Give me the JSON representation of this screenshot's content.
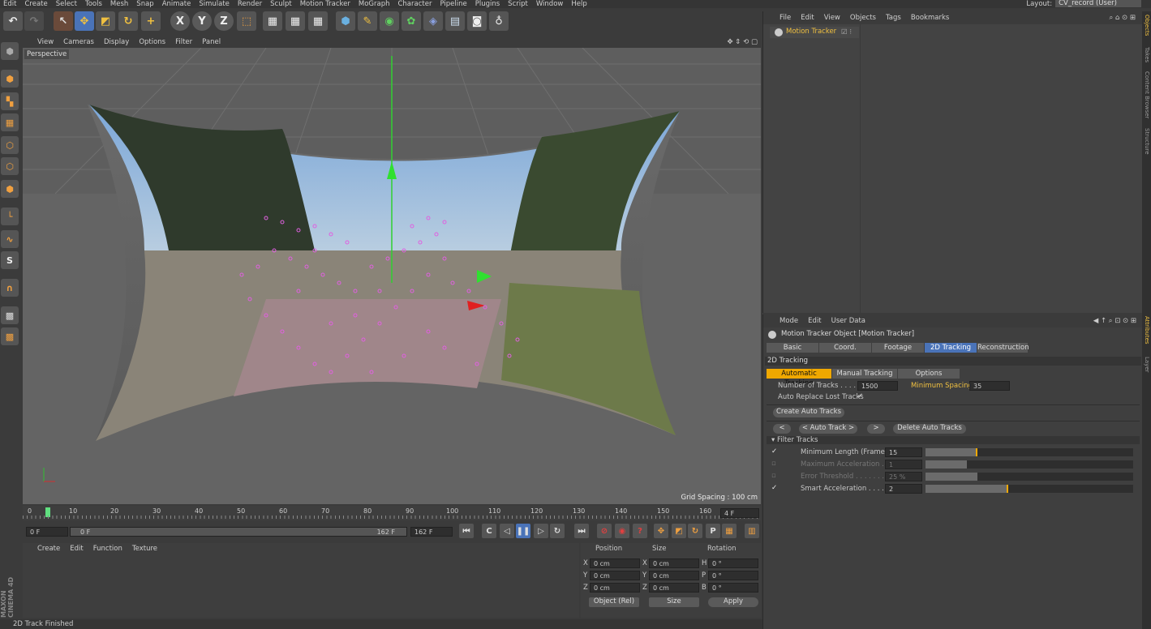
{
  "menu": [
    "Edit",
    "Create",
    "Select",
    "Tools",
    "Mesh",
    "Snap",
    "Animate",
    "Simulate",
    "Render",
    "Sculpt",
    "Motion Tracker",
    "MoGraph",
    "Character",
    "Pipeline",
    "Plugins",
    "Script",
    "Window",
    "Help"
  ],
  "layout": {
    "label": "Layout:",
    "value": "CV_record (User)"
  },
  "viewport": {
    "menu": [
      "View",
      "Cameras",
      "Display",
      "Options",
      "Filter",
      "Panel"
    ],
    "label": "Perspective",
    "grid_spacing": "Grid Spacing : 100 cm"
  },
  "timeline": {
    "ticks": [
      "0",
      "10",
      "20",
      "30",
      "40",
      "50",
      "60",
      "70",
      "80",
      "90",
      "100",
      "110",
      "120",
      "130",
      "140",
      "150",
      "160"
    ],
    "current": "4 F",
    "start": "0 F",
    "range_start": "0 F",
    "range_end": "162 F",
    "end": "162 F"
  },
  "material": {
    "menu": [
      "Create",
      "Edit",
      "Function",
      "Texture"
    ]
  },
  "coords": {
    "headers": [
      "Position",
      "Size",
      "Rotation"
    ],
    "rows": [
      {
        "a": "X",
        "av": "0 cm",
        "b": "X",
        "bv": "0 cm",
        "c": "H",
        "cv": "0 °"
      },
      {
        "a": "Y",
        "av": "0 cm",
        "b": "Y",
        "bv": "0 cm",
        "c": "P",
        "cv": "0 °"
      },
      {
        "a": "Z",
        "av": "0 cm",
        "b": "Z",
        "bv": "0 cm",
        "c": "B",
        "cv": "0 °"
      }
    ],
    "mode": "Object (Rel)",
    "size_mode": "Size",
    "apply": "Apply"
  },
  "status": "2D Track Finished",
  "branding": "MAXON CINEMA 4D",
  "objects": {
    "menu": [
      "File",
      "Edit",
      "View",
      "Objects",
      "Tags",
      "Bookmarks"
    ],
    "items": [
      {
        "name": "Motion Tracker"
      }
    ]
  },
  "attributes": {
    "menu": [
      "Mode",
      "Edit",
      "User Data"
    ],
    "title": "Motion Tracker Object [Motion Tracker]",
    "tabs": [
      "Basic",
      "Coord.",
      "Footage",
      "2D Tracking",
      "Reconstruction"
    ],
    "section": "2D Tracking",
    "subtabs": [
      "Automatic Tracking",
      "Manual Tracking",
      "Options"
    ],
    "num_tracks_label": "Number of Tracks . . . . . .",
    "num_tracks": "1500",
    "min_spacing_label": "Minimum Spacing",
    "min_spacing": "35",
    "auto_replace": "Auto Replace Lost Tracks",
    "create_btn": "Create Auto Tracks",
    "nav": [
      "<",
      "< Auto Track >",
      ">",
      "Delete Auto Tracks"
    ],
    "filter": "Filter Tracks",
    "filters": [
      {
        "label": "Minimum Length (Frames)",
        "value": "15",
        "checked": true,
        "level": 0.25
      },
      {
        "label": "Maximum Acceleration . . .",
        "value": "1",
        "checked": false,
        "level": 0.2
      },
      {
        "label": "Error Threshold . . . . . . . .",
        "value": "25 %",
        "checked": false,
        "level": 0.25
      },
      {
        "label": "Smart Acceleration . . . . . .",
        "value": "2",
        "checked": true,
        "level": 0.4
      }
    ]
  },
  "sidetabs": [
    "Objects",
    "Takes",
    "Content Browser",
    "Structure",
    "Attributes",
    "Layer"
  ]
}
